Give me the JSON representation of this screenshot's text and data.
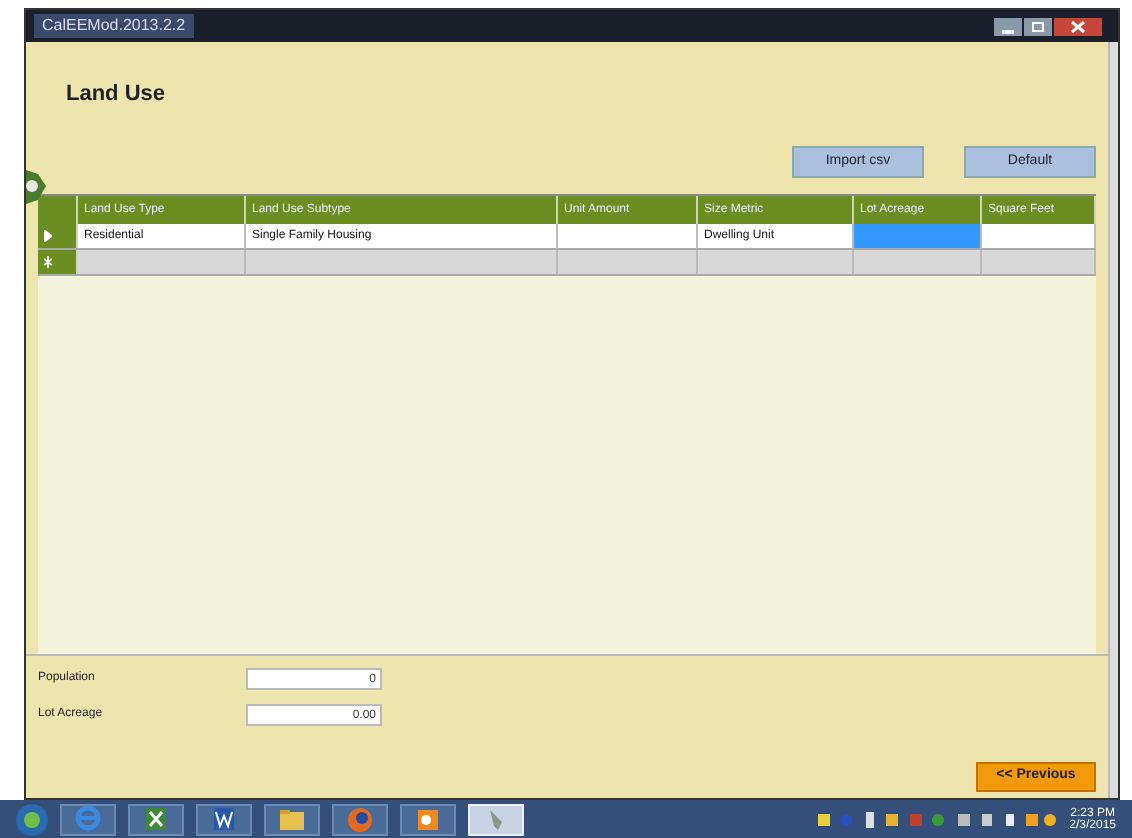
{
  "window": {
    "title": "CalEEMod.2013.2.2"
  },
  "page": {
    "title": "Land Use"
  },
  "buttons": [
    {
      "label": "Import csv"
    },
    {
      "label": "Default"
    }
  ],
  "table": {
    "columns": [
      "Land Use Type",
      "Land Use Subtype",
      "Unit Amount",
      "Size Metric",
      "Lot Acreage",
      "Square Feet"
    ],
    "rows": [
      {
        "kind": "current",
        "cells": [
          {
            "text": "Residential",
            "selected": false
          },
          {
            "text": "Single Family Housing",
            "selected": false
          },
          {
            "selected": false
          },
          {
            "text": "Dwelling Unit",
            "selected": false
          },
          {
            "selected": true
          },
          {
            "selected": false
          }
        ]
      },
      {
        "kind": "new",
        "cells": [
          {
            "selected": false
          },
          {
            "selected": false
          },
          {
            "selected": false
          },
          {
            "selected": false
          },
          {
            "selected": false
          },
          {
            "selected": false
          }
        ]
      }
    ]
  },
  "fields": [
    {
      "label": "Population",
      "value": "0"
    },
    {
      "label": "Lot Acreage",
      "value": "0.00"
    }
  ],
  "nav_button": {
    "label": "<< Previous"
  },
  "taskbar": {
    "apps": [
      {
        "kind": "ie",
        "selected": false
      },
      {
        "kind": "excel",
        "selected": false
      },
      {
        "kind": "word",
        "selected": false
      },
      {
        "kind": "folder",
        "selected": false
      },
      {
        "kind": "firefox",
        "selected": false
      },
      {
        "kind": "outlook",
        "selected": false
      },
      {
        "kind": "tool",
        "selected": true
      }
    ],
    "time": "2:23 PM",
    "date": "2/3/2015"
  }
}
